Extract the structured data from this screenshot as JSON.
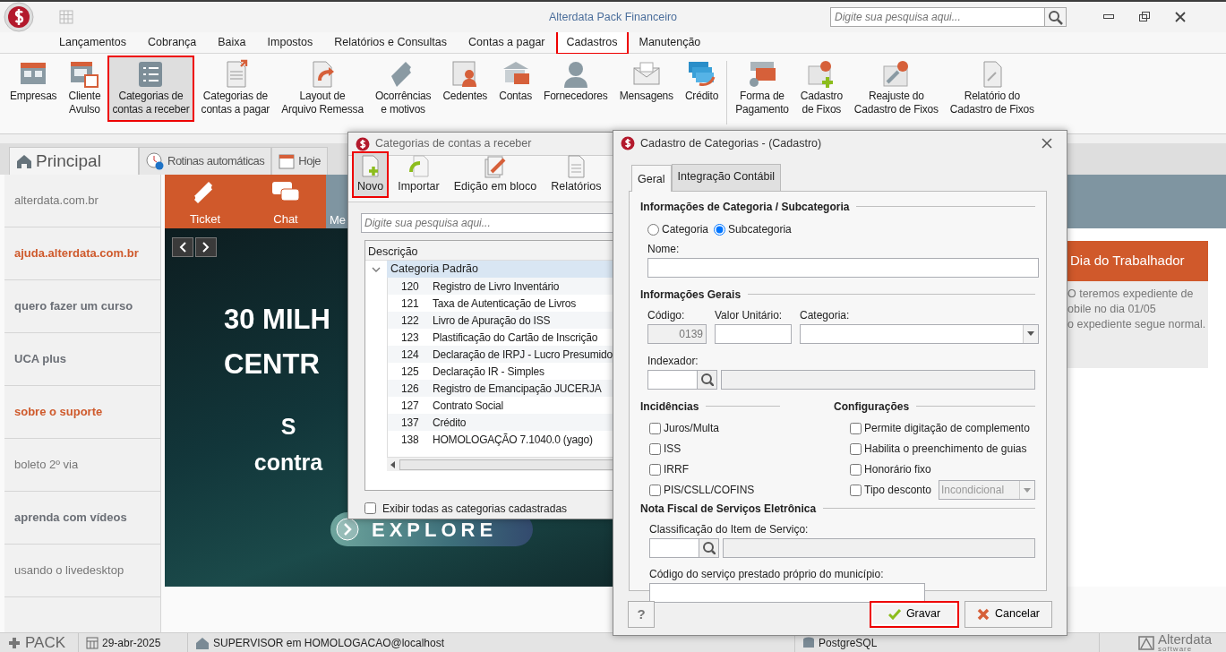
{
  "window": {
    "title": "Alterdata Pack Financeiro",
    "search_placeholder": "Digite sua pesquisa aqui..."
  },
  "menu": [
    {
      "label": "Lançamentos",
      "selected": false
    },
    {
      "label": "Cobrança",
      "selected": false
    },
    {
      "label": "Baixa",
      "selected": false
    },
    {
      "label": "Impostos",
      "selected": false
    },
    {
      "label": "Relatórios e Consultas",
      "selected": false
    },
    {
      "label": "Contas a pagar",
      "selected": false
    },
    {
      "label": "Cadastros",
      "selected": true
    },
    {
      "label": "Manutenção",
      "selected": false
    }
  ],
  "ribbon_groups": [
    {
      "items": [
        {
          "lines": [
            "Empresas"
          ],
          "selected": false
        },
        {
          "lines": [
            "Cliente",
            "Avulso"
          ],
          "selected": false
        },
        {
          "lines": [
            "Categorias de",
            "contas a receber"
          ],
          "selected": true
        },
        {
          "lines": [
            "Categorias de",
            "contas a pagar"
          ],
          "selected": false
        },
        {
          "lines": [
            "Layout de",
            "Arquivo Remessa"
          ],
          "selected": false
        },
        {
          "lines": [
            "Ocorrências",
            "e motivos"
          ],
          "selected": false
        },
        {
          "lines": [
            "Cedentes"
          ],
          "selected": false
        },
        {
          "lines": [
            "Contas"
          ],
          "selected": false
        },
        {
          "lines": [
            "Fornecedores"
          ],
          "selected": false
        },
        {
          "lines": [
            "Mensagens"
          ],
          "selected": false
        },
        {
          "lines": [
            "Crédito"
          ],
          "selected": false
        }
      ]
    },
    {
      "items": [
        {
          "lines": [
            "Forma de",
            "Pagamento"
          ],
          "selected": false
        },
        {
          "lines": [
            "Cadastro",
            "de Fixos"
          ],
          "selected": false
        },
        {
          "lines": [
            "Reajuste do",
            "Cadastro de Fixos"
          ],
          "selected": false
        },
        {
          "lines": [
            "Relatório do",
            "Cadastro de Fixos"
          ],
          "selected": false
        }
      ]
    }
  ],
  "tabs": [
    {
      "label": "Principal",
      "selected": true
    },
    {
      "label": "Rotinas automáticas",
      "selected": false
    },
    {
      "label": "Hoje",
      "selected": false
    }
  ],
  "sidebar": {
    "items": [
      {
        "label": "alterdata.com.br",
        "bold": false,
        "highlighted": false
      },
      {
        "label": "ajuda.alterdata.com.br",
        "bold": true,
        "highlighted": true
      },
      {
        "label": "quero fazer um curso",
        "bold": true,
        "highlighted": false
      },
      {
        "label": "UCA plus",
        "bold": true,
        "highlighted": false
      },
      {
        "label": "sobre o suporte",
        "bold": true,
        "highlighted": true
      },
      {
        "label": "boleto 2º via",
        "bold": false,
        "highlighted": false
      },
      {
        "label": "aprenda com vídeos",
        "bold": true,
        "highlighted": false
      },
      {
        "label": "usando o livedesktop",
        "bold": false,
        "highlighted": false
      }
    ]
  },
  "quick_links": [
    {
      "label": "Ticket"
    },
    {
      "label": "Chat"
    },
    {
      "label": "Me"
    }
  ],
  "banner": {
    "headline": [
      "30 MILH",
      "CENTR"
    ],
    "subline": [
      "S",
      "contra"
    ],
    "button": "EXPLORE"
  },
  "news": {
    "title": "Dia do Trabalhador",
    "lines": [
      "O teremos expediente de",
      "obile no dia 01/05",
      "o expediente segue normal."
    ]
  },
  "list_dialog": {
    "title": "Categorias de contas a receber",
    "toolbar": [
      {
        "label": "Novo",
        "selected": true
      },
      {
        "label": "Importar",
        "selected": false
      },
      {
        "label": "Edição em bloco",
        "selected": false
      },
      {
        "label": "Relatórios",
        "selected": false
      }
    ],
    "search_placeholder": "Digite sua pesquisa aqui...",
    "column": "Descrição",
    "group": {
      "label": "Categoria Padrão",
      "expanded": true,
      "children": [
        {
          "code": "120",
          "name": "Registro de Livro Inventário"
        },
        {
          "code": "121",
          "name": "Taxa de Autenticação de Livros"
        },
        {
          "code": "122",
          "name": "Livro de Apuração do ISS"
        },
        {
          "code": "123",
          "name": "Plastificação do Cartão de Inscrição"
        },
        {
          "code": "124",
          "name": "Declaração de IRPJ - Lucro Presumido"
        },
        {
          "code": "125",
          "name": "Declaração IR - Simples"
        },
        {
          "code": "126",
          "name": "Registro de Emancipação JUCERJA"
        },
        {
          "code": "127",
          "name": "Contrato Social"
        },
        {
          "code": "137",
          "name": "Crédito"
        },
        {
          "code": "138",
          "name": "HOMOLOGAÇÃO 7.1040.0 (yago)"
        }
      ]
    },
    "show_all": {
      "label": "Exibir todas as categorias cadastradas",
      "checked": false
    }
  },
  "form_dialog": {
    "title": "Cadastro de Categorias - (Cadastro)",
    "tabs": [
      {
        "label": "Geral",
        "selected": true
      },
      {
        "label": "Integração Contábil",
        "selected": false
      }
    ],
    "category_section": {
      "title": "Informações de Categoria / Subcategoria",
      "options": [
        {
          "label": "Categoria",
          "selected": false
        },
        {
          "label": "Subcategoria",
          "selected": true
        }
      ],
      "name_label": "Nome:"
    },
    "general_section": {
      "title": "Informações Gerais",
      "code": {
        "label": "Código:",
        "value": "0139",
        "disabled": true
      },
      "unit_value": {
        "label": "Valor Unitário:"
      },
      "category": {
        "label": "Categoria:"
      },
      "indexer": {
        "label": "Indexador:"
      }
    },
    "incidences": {
      "title": "Incidências",
      "items": [
        {
          "label": "Juros/Multa",
          "checked": false
        },
        {
          "label": "ISS",
          "checked": false
        },
        {
          "label": "IRRF",
          "checked": false
        },
        {
          "label": "PIS/CSLL/COFINS",
          "checked": false
        }
      ]
    },
    "settings": {
      "title": "Configurações",
      "items": [
        {
          "label": "Permite digitação de complemento",
          "checked": false,
          "kind": "plain"
        },
        {
          "label": "Habilita o preenchimento de guias",
          "checked": false,
          "kind": "plain"
        },
        {
          "label": "Honorário fixo",
          "checked": false,
          "kind": "plain"
        },
        {
          "label": "Tipo desconto",
          "checked": false,
          "kind": "dropdown",
          "value": "Incondicional",
          "disabled": true
        }
      ]
    },
    "nfse_section": {
      "title": "Nota Fiscal de Serviços Eletrônica",
      "service_item": {
        "label": "Classificação do Item de Serviço:"
      },
      "service_code": {
        "label": "Código do serviço prestado próprio do município:"
      }
    },
    "buttons": [
      {
        "kind": "help",
        "label": "?",
        "highlighted": false
      },
      {
        "kind": "save",
        "label": "Gravar",
        "highlighted": true
      },
      {
        "kind": "cancel",
        "label": "Cancelar",
        "highlighted": false
      }
    ]
  },
  "status_bar": {
    "product": "PACK",
    "date": "29-abr-2025",
    "user": "SUPERVISOR em HOMOLOGACAO@localhost",
    "database": "PostgreSQL",
    "logo": "Alterdata",
    "logo_sub": "software"
  }
}
